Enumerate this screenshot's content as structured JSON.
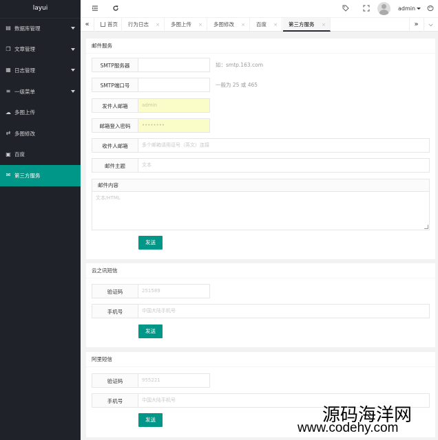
{
  "sidebar": {
    "logo": "layui",
    "items": [
      {
        "label": "数据库管理",
        "icon": "database-icon",
        "has_submenu": true
      },
      {
        "label": "文章管理",
        "icon": "copy-icon",
        "has_submenu": true
      },
      {
        "label": "日志管理",
        "icon": "table-icon",
        "has_submenu": true
      },
      {
        "label": "一级菜单",
        "icon": "list-icon",
        "has_submenu": true
      },
      {
        "label": "多图上传",
        "icon": "cloud-upload-icon",
        "has_submenu": false
      },
      {
        "label": "多图修改",
        "icon": "exchange-icon",
        "has_submenu": false
      },
      {
        "label": "百度",
        "icon": "image-icon",
        "has_submenu": false
      },
      {
        "label": "第三方服务",
        "icon": "mail-icon",
        "has_submenu": false,
        "active": true
      }
    ]
  },
  "header": {
    "user": "admin",
    "icons": [
      "menu-toggle-icon",
      "refresh-icon",
      "tag-icon",
      "fullscreen-icon",
      "avatar"
    ]
  },
  "tabs": {
    "items": [
      {
        "label": "首页",
        "home": true,
        "closable": false
      },
      {
        "label": "行为日志",
        "closable": true
      },
      {
        "label": "多图上传",
        "closable": true
      },
      {
        "label": "多图修改",
        "closable": true
      },
      {
        "label": "百度",
        "closable": true
      },
      {
        "label": "第三方服务",
        "closable": true,
        "active": true
      }
    ],
    "close_glyph": "×"
  },
  "mail": {
    "title": "邮件服务",
    "smtp_server_label": "SMTP服务器",
    "smtp_server_hint": "如：smtp.163.com",
    "smtp_port_label": "SMTP端口号",
    "smtp_port_hint": "一般为 25 或 465",
    "sender_label": "发件人邮箱",
    "sender_value": "admin",
    "password_label": "邮箱登入密码",
    "password_value": "••••••••",
    "recipient_label": "收件人邮箱",
    "recipient_placeholder": "多个邮箱请用逗号（英文）连接",
    "subject_label": "邮件主题",
    "subject_placeholder": "文本",
    "body_label": "邮件内容",
    "body_placeholder": "文本/HTML",
    "send_label": "发送"
  },
  "yunzhixun": {
    "title": "云之讯短信",
    "code_label": "验证码",
    "code_placeholder": "251589",
    "phone_label": "手机号",
    "phone_placeholder": "中国大陆手机号",
    "send_label": "发送"
  },
  "aliyun": {
    "title": "阿里短信",
    "code_label": "验证码",
    "code_placeholder": "955221",
    "phone_label": "手机号",
    "phone_placeholder": "中国大陆手机号",
    "send_label": "发送"
  },
  "watermark": {
    "line1": "源码海洋网",
    "line2": "www.codehy.com"
  },
  "colors": {
    "sidebar_bg": "#20222a",
    "accent": "#009688",
    "autofill_bg": "#fafdc8"
  }
}
